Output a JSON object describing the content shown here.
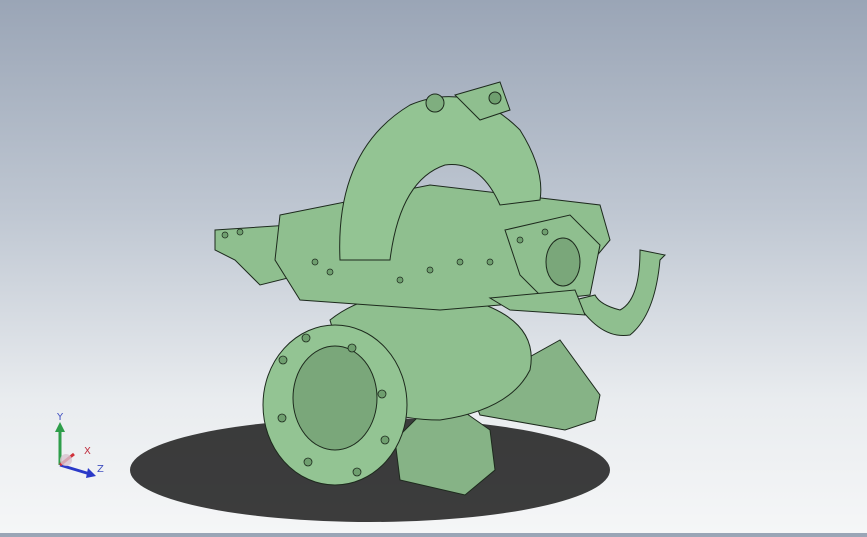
{
  "viewport": {
    "background_top": "#9aa5b6",
    "background_bottom": "#f5f6f7",
    "model_color": "#8fbf8f",
    "model_edge_color": "#1d2a1d",
    "shadow_color": "#1b1b1b"
  },
  "triad": {
    "x_label": "X",
    "y_label": "Y",
    "z_label": "Z",
    "x_color": "#d0303a",
    "y_color": "#2e9e4a",
    "z_color": "#2a39c8"
  }
}
